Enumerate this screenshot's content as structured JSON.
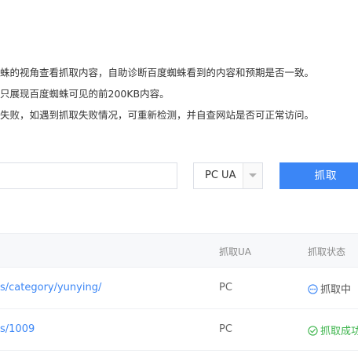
{
  "description": {
    "line1": "蛛的视角查看抓取内容，自助诊断百度蜘蛛看到的内容和预期是否一致。",
    "line2": "只展现百度蜘蛛可见的前200KB内容。",
    "line3": "失败，如遇到抓取失败情况，可重新检测，并自查网站是否可正常访问。"
  },
  "form": {
    "url_value": "",
    "ua_selected": "PC UA",
    "fetch_label": "抓取"
  },
  "table": {
    "headers": {
      "ua": "抓取UA",
      "status": "抓取状态"
    },
    "rows": [
      {
        "url": "s/category/yunying/",
        "ua": "PC",
        "status": "抓取中",
        "status_type": "pending"
      },
      {
        "url": "s/1009",
        "ua": "PC",
        "status": "抓取成功",
        "status_type": "success"
      }
    ]
  },
  "colors": {
    "accent": "#3b86f6",
    "success": "#3cb44b"
  }
}
